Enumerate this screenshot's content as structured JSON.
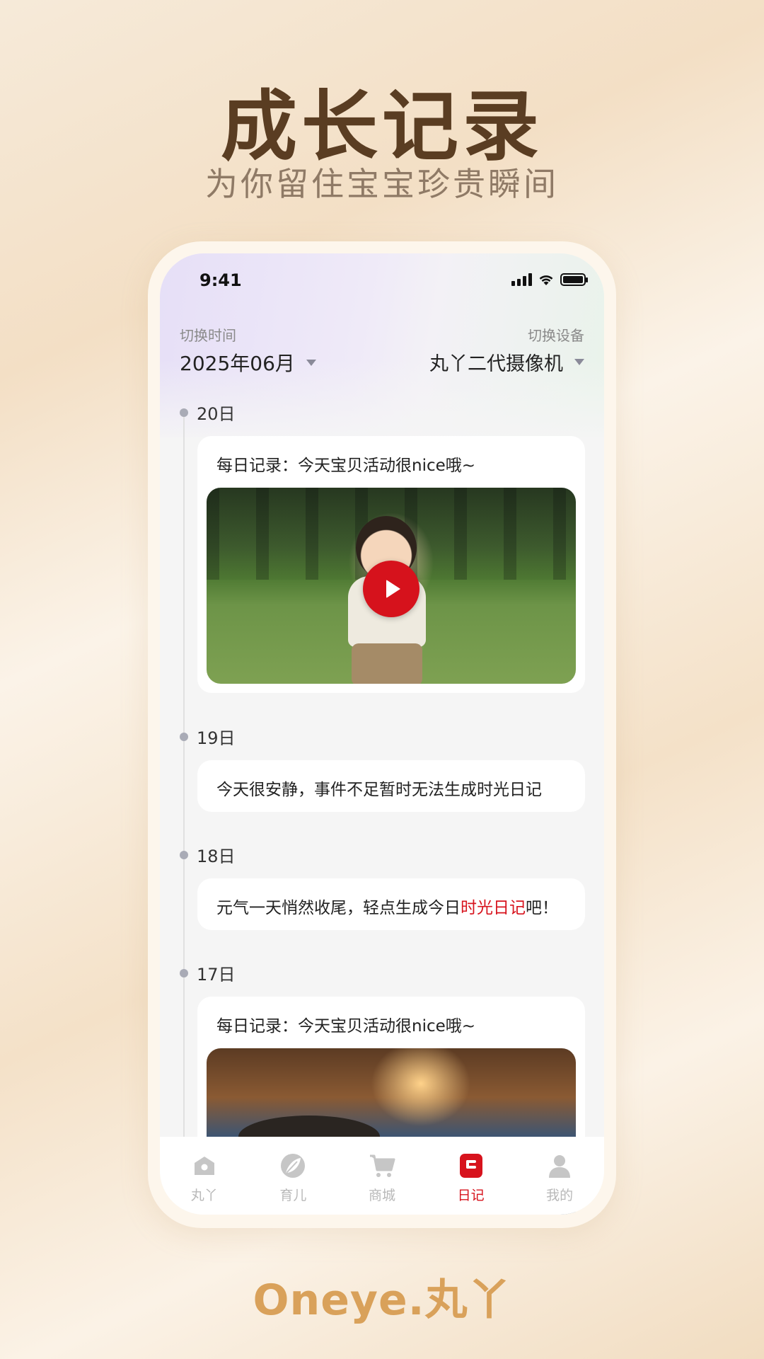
{
  "hero": {
    "title": "成长记录",
    "subtitle": "为你留住宝宝珍贵瞬间"
  },
  "status_bar": {
    "time": "9:41"
  },
  "header": {
    "time_label": "切换时间",
    "time_value": "2025年06月",
    "device_label": "切换设备",
    "device_value": "丸丫二代摄像机"
  },
  "timeline": [
    {
      "day": "20日",
      "text": "每日记录：今天宝贝活动很nice哦~",
      "media": "video"
    },
    {
      "day": "19日",
      "text": "今天很安静，事件不足暂时无法生成时光日记"
    },
    {
      "day": "18日",
      "text_before": "元气一天悄然收尾，轻点生成今日",
      "text_link": "时光日记",
      "text_after": "吧！"
    },
    {
      "day": "17日",
      "text": "每日记录：今天宝贝活动很nice哦~",
      "media": "photo"
    }
  ],
  "tabs": [
    {
      "label": "丸丫",
      "icon": "home-icon"
    },
    {
      "label": "育儿",
      "icon": "leaf-icon"
    },
    {
      "label": "商城",
      "icon": "cart-icon"
    },
    {
      "label": "日记",
      "icon": "diary-icon",
      "active": true
    },
    {
      "label": "我的",
      "icon": "person-icon"
    }
  ],
  "brand": {
    "logo_text": "Oneye.丸丫"
  },
  "colors": {
    "accent": "#d7131d",
    "title": "#5a3d22",
    "logo": "#d9a15a",
    "inactive_tab": "#b9b9b9"
  }
}
